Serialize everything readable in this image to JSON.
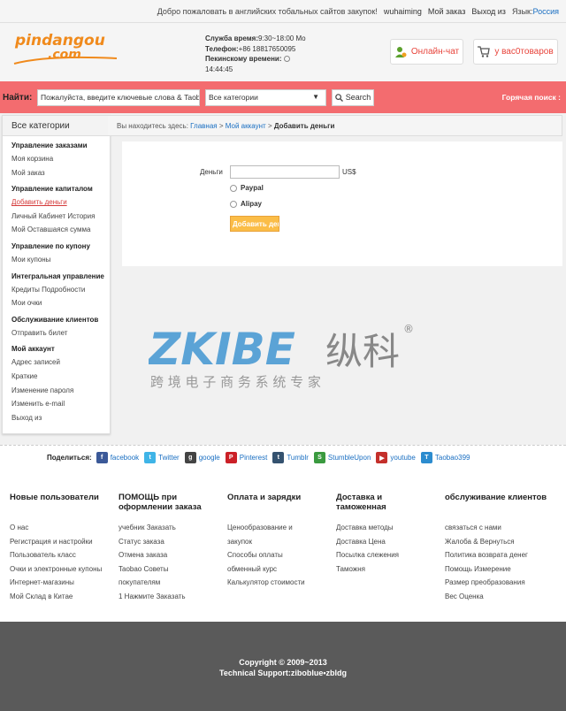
{
  "topbar": {
    "welcome": "Добро пожаловать в английских тобальных сайтов закупок!",
    "username": "wuhaiming",
    "my_orders": "Мой заказ",
    "logout": "Выход из",
    "lang_label": "Язык:",
    "lang_value": "Россия"
  },
  "header": {
    "logo_line1": "pindangou",
    "logo_line2": ".com",
    "hours_label": "Служба время:",
    "hours_value": "9:30~18:00 Mo",
    "phone_label": "Телефон:",
    "phone_value": "+86 18817650095",
    "beijing_label": "Пекинскому времени:",
    "time_value": "14:44:45",
    "chat_label": "Онлайн-чат",
    "cart_label": "у вас0товаров"
  },
  "search": {
    "find_label": "Найти:",
    "input_value": "Пожалуйста, введите ключевые слова & Taob",
    "category_value": "Все категории",
    "button_label": "Search",
    "hot_label": "Горячая поиск :"
  },
  "sidebar": {
    "title": "Все категории",
    "groups": [
      {
        "title": "Управление заказами",
        "items": [
          "Моя корзина",
          "Мой заказ"
        ]
      },
      {
        "title": "Управление капиталом",
        "items": [
          "Добавить деньги",
          "Личный Кабинет История",
          "Мой Оставшаяся сумма"
        ]
      },
      {
        "title": "Управление по купону",
        "items": [
          "Мои купоны"
        ]
      },
      {
        "title": "Интегральная управление",
        "items": [
          "Кредиты Подробности",
          "Мои очки"
        ]
      },
      {
        "title": "Обслуживание клиентов",
        "items": [
          "Отправить билет"
        ]
      },
      {
        "title": "Мой аккаунт",
        "items": [
          "Адрес записей",
          "Краткие",
          "Изменение пароля",
          "Изменить e-mail",
          "Выход из"
        ]
      }
    ]
  },
  "breadcrumb": {
    "prefix": "Вы находитесь здесь:",
    "home": "Главная",
    "sep1": ">",
    "account": "Мой аккаунт",
    "sep2": ">",
    "current": "Добавить деньги"
  },
  "form": {
    "money_label": "Деньги",
    "money_value": "",
    "currency": "US$",
    "option1": "Paypal",
    "option2": "Alipay",
    "submit_label": "Добавить деньги"
  },
  "watermark": {
    "brand": "ZKIBE",
    "cn_name": "纵科",
    "tagline": "跨 境 电 子 商 务 系 统 专 家",
    "registered": "®"
  },
  "share": {
    "label": "Поделиться:",
    "items": [
      "facebook",
      "Twitter",
      "google",
      "Pinterest",
      "Tumblr",
      "StumbleUpon",
      "youtube",
      "Taobao399"
    ]
  },
  "footer": {
    "columns": [
      {
        "title": "Новые пользователи",
        "links": [
          "О нас",
          "Регистрация и настройки",
          "Пользователь класс",
          "Очки и электронные купоны",
          "Интернет-магазины",
          "Мой Склад в Китае"
        ]
      },
      {
        "title": "ПОМОЩЬ при оформлении заказа",
        "links": [
          "учебник Заказать",
          "Статус заказа",
          "Отмена заказа",
          "Taobao Советы",
          "покупателям",
          "1 Нажмите Заказать"
        ]
      },
      {
        "title": "Оплата и зарядки",
        "links": [
          "Ценообразование и",
          "закупок",
          "Способы оплаты",
          "обменный курс",
          "Калькулятор стоимости"
        ]
      },
      {
        "title": "Доставка и таможенная",
        "links": [
          "Доставка методы",
          "Доставка Цена",
          "Посылка слежения",
          "Таможня"
        ]
      },
      {
        "title": "обслуживание клиентов",
        "links": [
          "связаться с нами",
          "Жалоба & Вернуться",
          "Политика возврата денег",
          "Помощь Измерение",
          "Размер преобразования",
          "Вес Оценка"
        ]
      }
    ],
    "copyright": "Copyright © 2009~2013",
    "support": "Technical Support:ziboblue•zbldg"
  },
  "colors": {
    "accent": "#f36c6f",
    "link": "#1a6fc2",
    "orange": "#f08a1c",
    "submit": "#fbbd47"
  }
}
